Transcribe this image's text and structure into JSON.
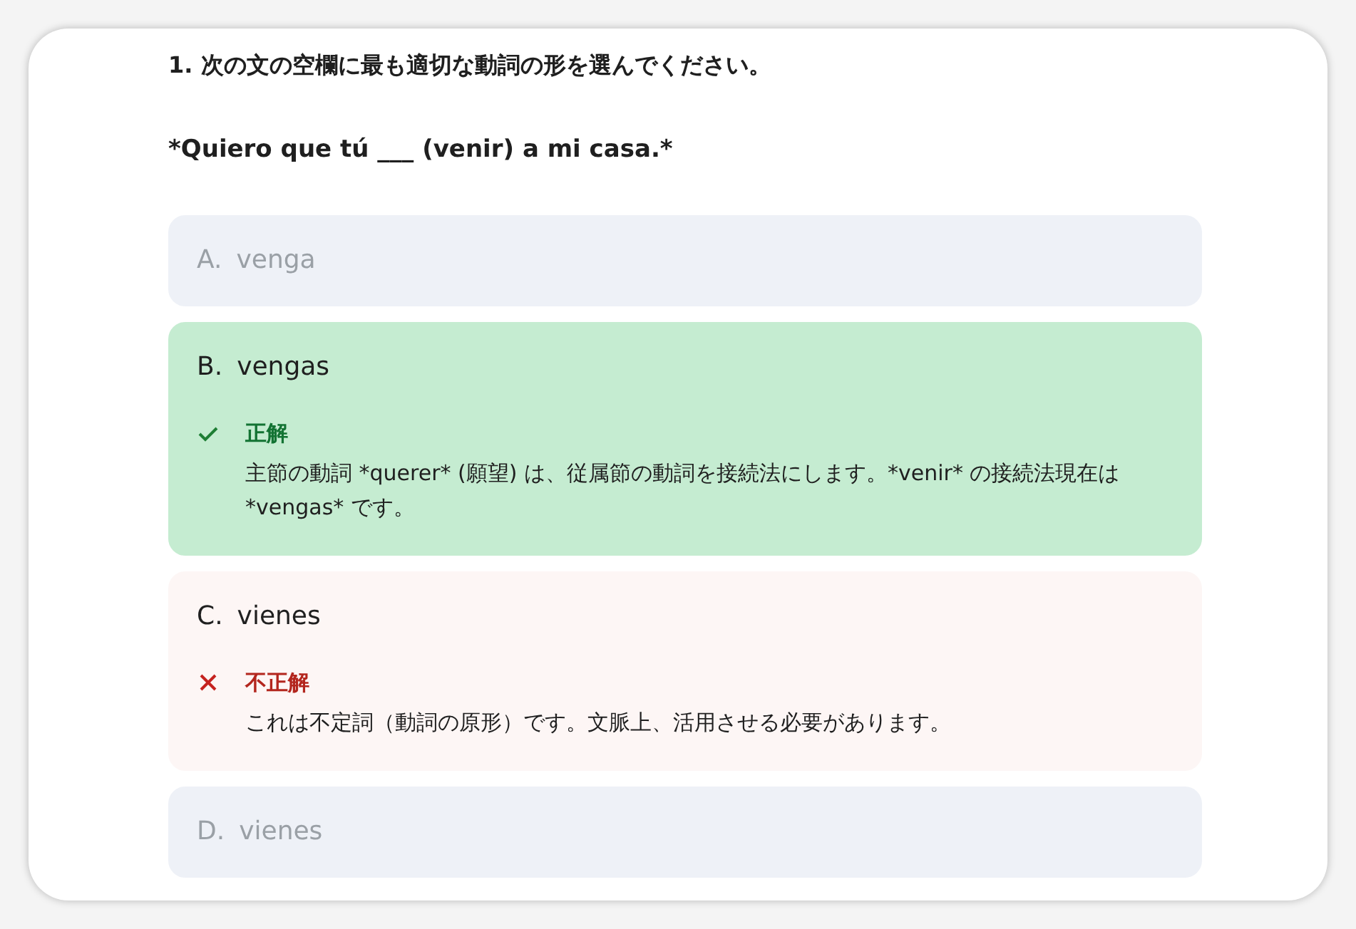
{
  "question": {
    "title": "1. 次の文の空欄に最も適切な動詞の形を選んでください。",
    "sentence": "*Quiero que tú ___ (venir) a mi casa.*"
  },
  "options": [
    {
      "letter": "A.",
      "text": "venga",
      "kind": "neutral"
    },
    {
      "letter": "B.",
      "text": "vengas",
      "kind": "correct",
      "feedback": {
        "label": "正解",
        "text": "主節の動詞 *querer* (願望) は、従属節の動詞を接続法にします。*venir* の接続法現在は *vengas* です。"
      }
    },
    {
      "letter": "C.",
      "text": "vienes",
      "kind": "incorrect",
      "feedback": {
        "label": "不正解",
        "text": "これは不定詞（動詞の原形）です。文脈上、活用させる必要があります。"
      }
    },
    {
      "letter": "D.",
      "text": "vienes",
      "kind": "neutral"
    }
  ]
}
